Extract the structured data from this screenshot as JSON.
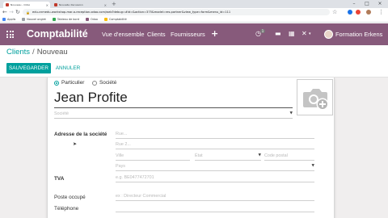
{
  "browser": {
    "tabs": [
      {
        "label": "Nouveau - Odoo",
        "fav_color": "#c0392b",
        "active": true
      },
      {
        "label": "Nouvelle discussion",
        "fav_color": "#c0392b",
        "active": false
      }
    ],
    "url": "edu-cnmedu-workshop-mar-a-reception.odoo.com/web?debug=#id=&action=375&model=res.partner&view_type=form&menu_id=111",
    "bookmarks": [
      {
        "label": "Applis",
        "color": "#4285f4"
      },
      {
        "label": "Nouvel onglet",
        "color": "#9aa0a6"
      },
      {
        "label": "Tableau de bord",
        "color": "#34a853"
      },
      {
        "label": "Odoo",
        "color": "#875a7b"
      },
      {
        "label": "Comptabilité",
        "color": "#fbbc05"
      }
    ]
  },
  "navbar": {
    "app_title": "Comptabilité",
    "menu": [
      "Vue d'ensemble",
      "Clients",
      "Fournisseurs"
    ],
    "add_symbol": "+",
    "activity_count": "1",
    "user_name": "Formation Erkens",
    "color": "#875a7b"
  },
  "control_panel": {
    "breadcrumb_parent": "Clients",
    "breadcrumb_separator": "/",
    "breadcrumb_current": "Nouveau",
    "save_label": "SAUVEGARDER",
    "discard_label": "ANNULER",
    "accent_color": "#00a09d"
  },
  "form": {
    "company_type_options": [
      {
        "label": "Particulier",
        "selected": true
      },
      {
        "label": "Société",
        "selected": false
      }
    ],
    "customer_name": "Jean Profite",
    "company_placeholder": "Société",
    "photo_icon": "camera-plus-icon",
    "address": {
      "label": "Adresse de la société",
      "street_placeholder": "Rue...",
      "street2_placeholder": "Rue 2...",
      "city_placeholder": "Ville",
      "state_placeholder": "État",
      "zip_placeholder": "Code postal",
      "country_placeholder": "Pays"
    },
    "vat": {
      "label": "TVA",
      "placeholder": "e.g. BE0477472701"
    },
    "function": {
      "label": "Poste occupé",
      "placeholder": "ex : Directeur Commercial"
    },
    "phone": {
      "label": "Téléphone"
    }
  }
}
